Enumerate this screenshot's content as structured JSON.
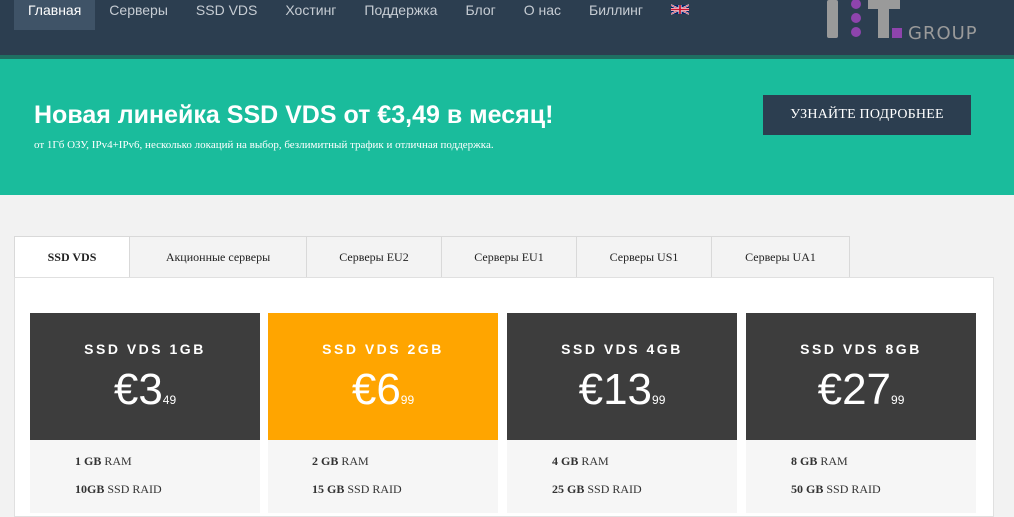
{
  "nav": {
    "items": [
      "Главная",
      "Серверы",
      "SSD VDS",
      "Хостинг",
      "Поддержка",
      "Блог",
      "О нас",
      "Биллинг"
    ],
    "active_index": 0,
    "language_icon": "uk-flag-icon",
    "logo_text": "GROUP"
  },
  "hero": {
    "title": "Новая линейка SSD VDS от €3,49 в месяц!",
    "subtitle": "от 1Гб ОЗУ, IPv4+IPv6, несколько локаций на выбор, безлимитный трафик и отличная поддержка.",
    "button": "УЗНАЙТЕ ПОДРОБНЕЕ"
  },
  "tabs": {
    "items": [
      "SSD VDS",
      "Акционные серверы",
      "Серверы EU2",
      "Серверы EU1",
      "Серверы US1",
      "Серверы UA1"
    ],
    "active_index": 0
  },
  "plans": [
    {
      "name": "SSD VDS 1GB",
      "price": "€3",
      "cents": "49",
      "ram_value": "1 GB",
      "ram_label": "RAM",
      "disk_value": "10GB",
      "disk_label": "SSD RAID",
      "featured": false
    },
    {
      "name": "SSD VDS 2GB",
      "price": "€6",
      "cents": "99",
      "ram_value": "2 GB",
      "ram_label": "RAM",
      "disk_value": "15 GB",
      "disk_label": "SSD RAID",
      "featured": true
    },
    {
      "name": "SSD VDS 4GB",
      "price": "€13",
      "cents": "99",
      "ram_value": "4 GB",
      "ram_label": "RAM",
      "disk_value": "25 GB",
      "disk_label": "SSD RAID",
      "featured": false
    },
    {
      "name": "SSD VDS 8GB",
      "price": "€27",
      "cents": "99",
      "ram_value": "8 GB",
      "ram_label": "RAM",
      "disk_value": "50 GB",
      "disk_label": "SSD RAID",
      "featured": false
    }
  ],
  "colors": {
    "nav_bg": "#2c3e50",
    "hero_bg": "#1abc9c",
    "card_dark": "#3d3d3d",
    "card_featured": "#ffa500",
    "logo_purple": "#8e44ad"
  }
}
